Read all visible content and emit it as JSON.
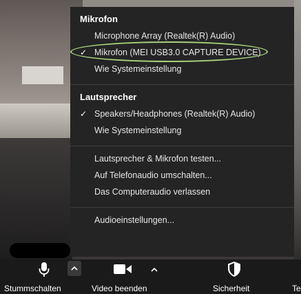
{
  "menu": {
    "sections": [
      {
        "title": "Mikrofon",
        "items": [
          {
            "label": "Microphone Array (Realtek(R) Audio)",
            "checked": false
          },
          {
            "label": "Mikrofon (MEI USB3.0 CAPTURE DEVICE)",
            "checked": true,
            "highlighted": true
          },
          {
            "label": "Wie Systemeinstellung",
            "checked": false
          }
        ]
      },
      {
        "title": "Lautsprecher",
        "items": [
          {
            "label": "Speakers/Headphones (Realtek(R) Audio)",
            "checked": true
          },
          {
            "label": "Wie Systemeinstellung",
            "checked": false
          }
        ]
      }
    ],
    "actions": [
      "Lautsprecher & Mikrofon testen...",
      "Auf Telefonaudio umschalten...",
      "Das Computeraudio verlassen"
    ],
    "settings": "Audioeinstellungen...",
    "check_glyph": "✓",
    "highlight_color": "#a6d07a"
  },
  "toolbar": {
    "mute": {
      "label": "Stummschalten",
      "icon": "microphone-icon"
    },
    "video": {
      "label": "Video beenden",
      "icon": "video-camera-icon"
    },
    "security": {
      "label": "Sicherheit",
      "icon": "shield-icon"
    },
    "next_label_partial": "Te"
  }
}
